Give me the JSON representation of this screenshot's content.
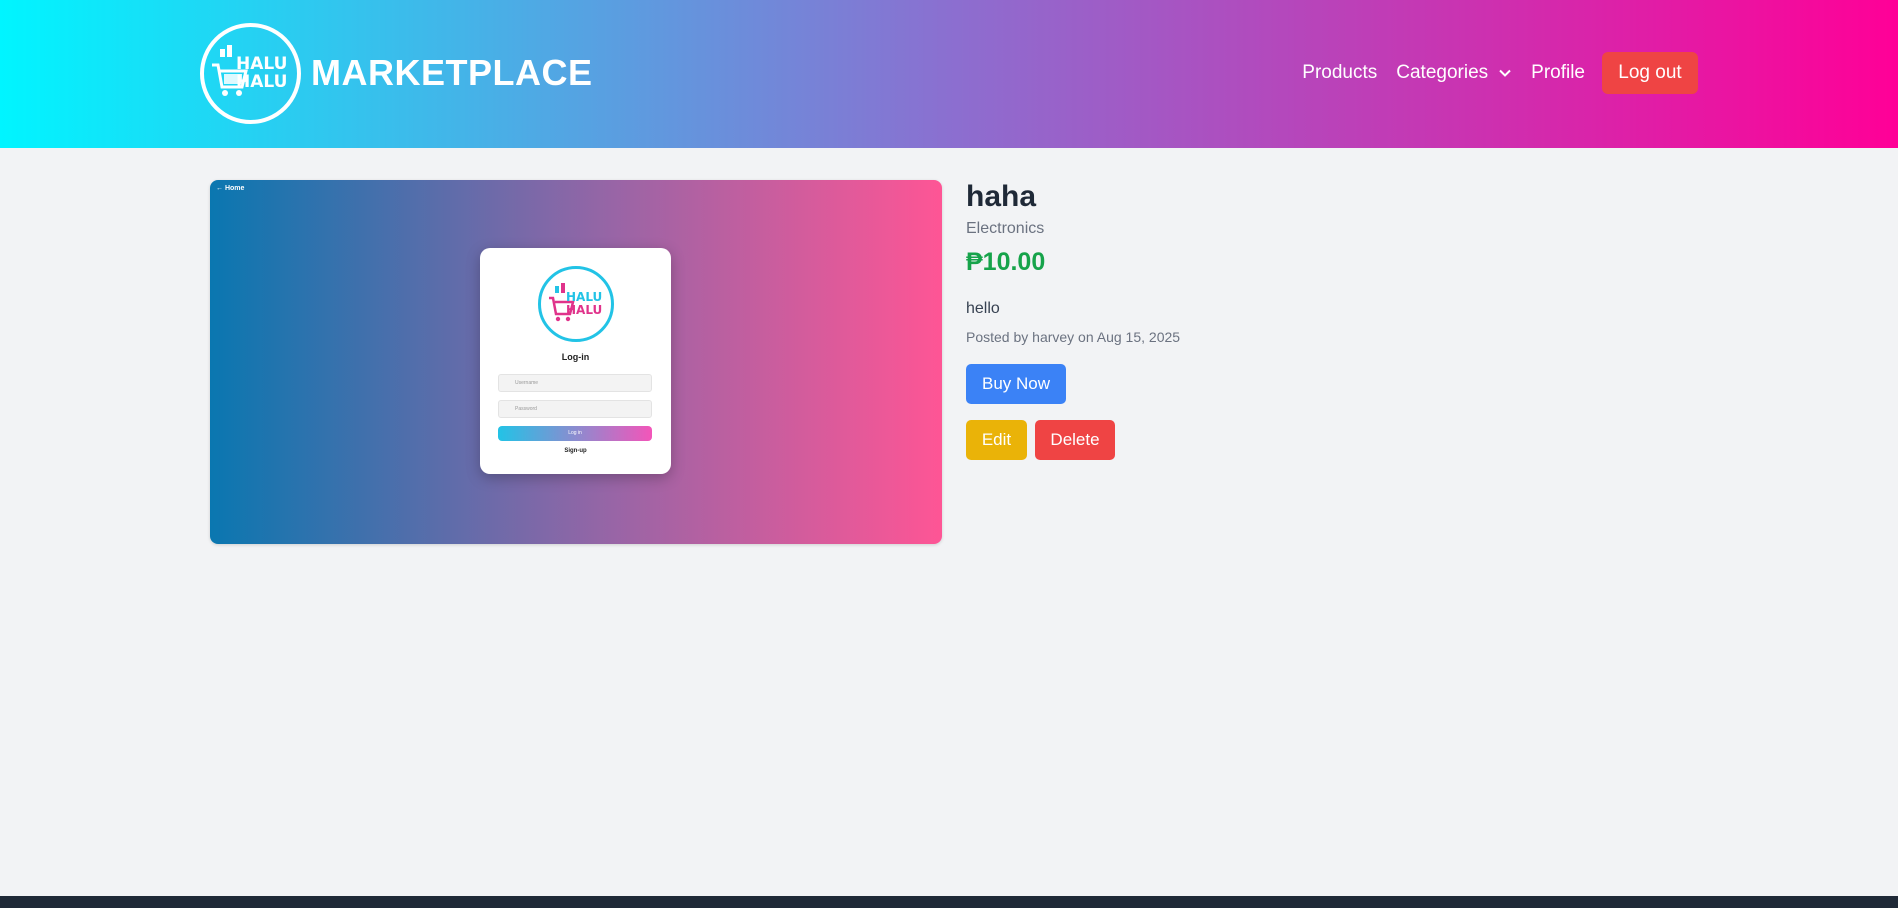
{
  "header": {
    "brand_logo_text": "HALU HALU",
    "brand_name": "MARKETPLACE",
    "nav": {
      "products": "Products",
      "categories": "Categories",
      "profile": "Profile",
      "logout": "Log out"
    }
  },
  "product": {
    "image": {
      "home_link": "← Home",
      "card_title": "Log-in",
      "username_placeholder": "Username",
      "password_placeholder": "Password",
      "login_button": "Log in",
      "signup_link": "Sign-up"
    },
    "title": "haha",
    "category": "Electronics",
    "price": "₱10.00",
    "description": "hello",
    "meta": "Posted by harvey on Aug 15, 2025",
    "buy_label": "Buy Now",
    "edit_label": "Edit",
    "delete_label": "Delete"
  },
  "colors": {
    "header_gradient_start": "#00f5ff",
    "header_gradient_end": "#ff0097",
    "price": "#16a34a",
    "buy": "#3b82f6",
    "edit": "#eab308",
    "delete": "#ef4444"
  }
}
